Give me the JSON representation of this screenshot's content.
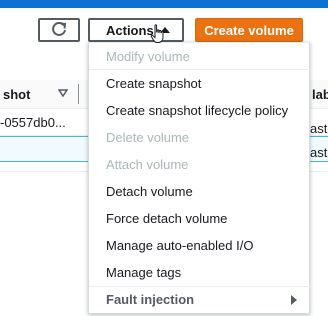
{
  "toolbar": {
    "actions_label": "Actions",
    "create_label": "Create volume"
  },
  "table": {
    "headers": [
      {
        "label": "shot"
      },
      {
        "label": "labi"
      }
    ],
    "rows": [
      {
        "snapshot": "-0557db0...",
        "zone": "ast-"
      },
      {
        "snapshot": "",
        "zone": "ast-"
      }
    ]
  },
  "menu": {
    "items": [
      {
        "label": "Modify volume",
        "enabled": false
      },
      {
        "label": "Create snapshot",
        "enabled": true
      },
      {
        "label": "Create snapshot lifecycle policy",
        "enabled": true
      },
      {
        "label": "Delete volume",
        "enabled": false
      },
      {
        "label": "Attach volume",
        "enabled": false
      },
      {
        "label": "Detach volume",
        "enabled": true
      },
      {
        "label": "Force detach volume",
        "enabled": true
      },
      {
        "label": "Manage auto-enabled I/O",
        "enabled": true
      },
      {
        "label": "Manage tags",
        "enabled": true
      }
    ],
    "fault_injection_label": "Fault injection"
  },
  "icons": {
    "refresh": "refresh-icon",
    "caret": "caret-up-icon",
    "filter": "sort-down-icon",
    "submenu": "caret-right-icon",
    "cursor": "hand-pointer-icon"
  },
  "colors": {
    "primary": "#ec7211",
    "header": "#0972d3",
    "disabled_text": "#aab7b8",
    "selected_row": "#f1faff"
  }
}
